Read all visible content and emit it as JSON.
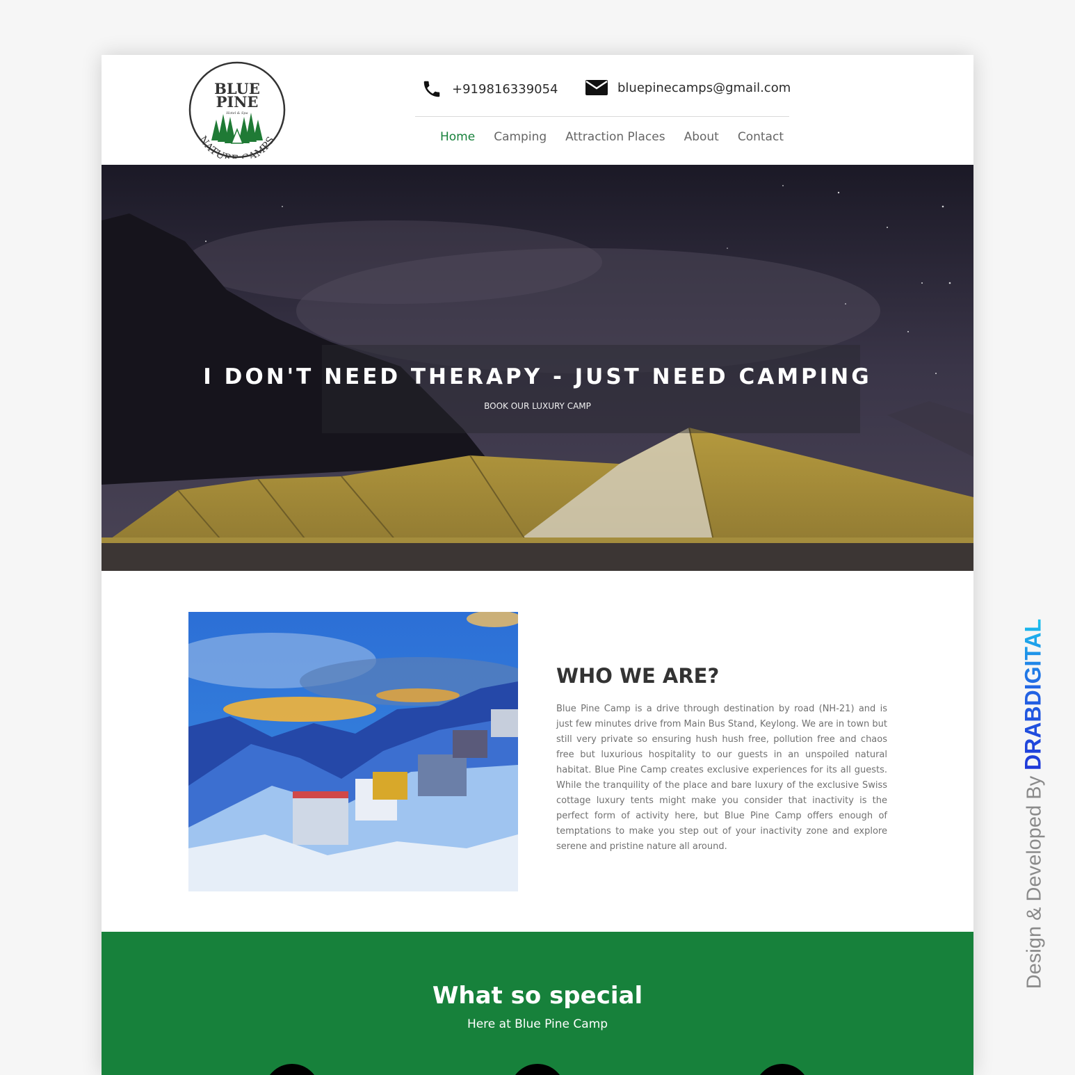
{
  "header": {
    "logo": {
      "line1": "BLUE",
      "line2": "PINE",
      "tagline": "Hotel & Spa",
      "arc_text": "NATURE CAMPS"
    },
    "phone": "+919816339054",
    "email": "bluepinecamps@gmail.com",
    "nav": [
      {
        "label": "Home",
        "active": true
      },
      {
        "label": "Camping",
        "active": false
      },
      {
        "label": "Attraction Places",
        "active": false
      },
      {
        "label": "About",
        "active": false
      },
      {
        "label": "Contact",
        "active": false
      }
    ]
  },
  "hero": {
    "title": "I DON'T NEED THERAPY - JUST NEED CAMPING",
    "subtitle": "BOOK OUR LUXURY CAMP",
    "slide_count": 3,
    "active_slide": 2
  },
  "about": {
    "heading": "WHO WE ARE?",
    "body": "Blue Pine Camp is a drive through destination by road (NH-21) and is just few minutes drive from Main Bus Stand, Keylong. We are in town but still very private so ensuring hush hush free, pollution free and chaos free but luxurious hospitality to our guests in an unspoiled natural habitat. Blue Pine Camp creates exclusive experiences for its all guests. While the tranquility of the place and bare luxury of the exclusive Swiss cottage luxury tents might make you consider that inactivity is the perfect form of activity here, but Blue Pine Camp offers enough of temptations to make you step out of your inactivity zone and explore serene and pristine nature all around."
  },
  "special": {
    "title": "What so special",
    "subtitle": "Here at Blue Pine Camp"
  },
  "side_credit": {
    "prefix": "Design & Developed By ",
    "brand": "DRABDIGITAL"
  },
  "colors": {
    "accent_green": "#17813b",
    "nav_text": "#666666",
    "page_bg": "#f6f6f6",
    "brand_blue": "#1f38d8",
    "brand_cyan": "#1bc3ee"
  },
  "icons": [
    "phone-icon",
    "mail-icon",
    "pine-trees-icon"
  ]
}
